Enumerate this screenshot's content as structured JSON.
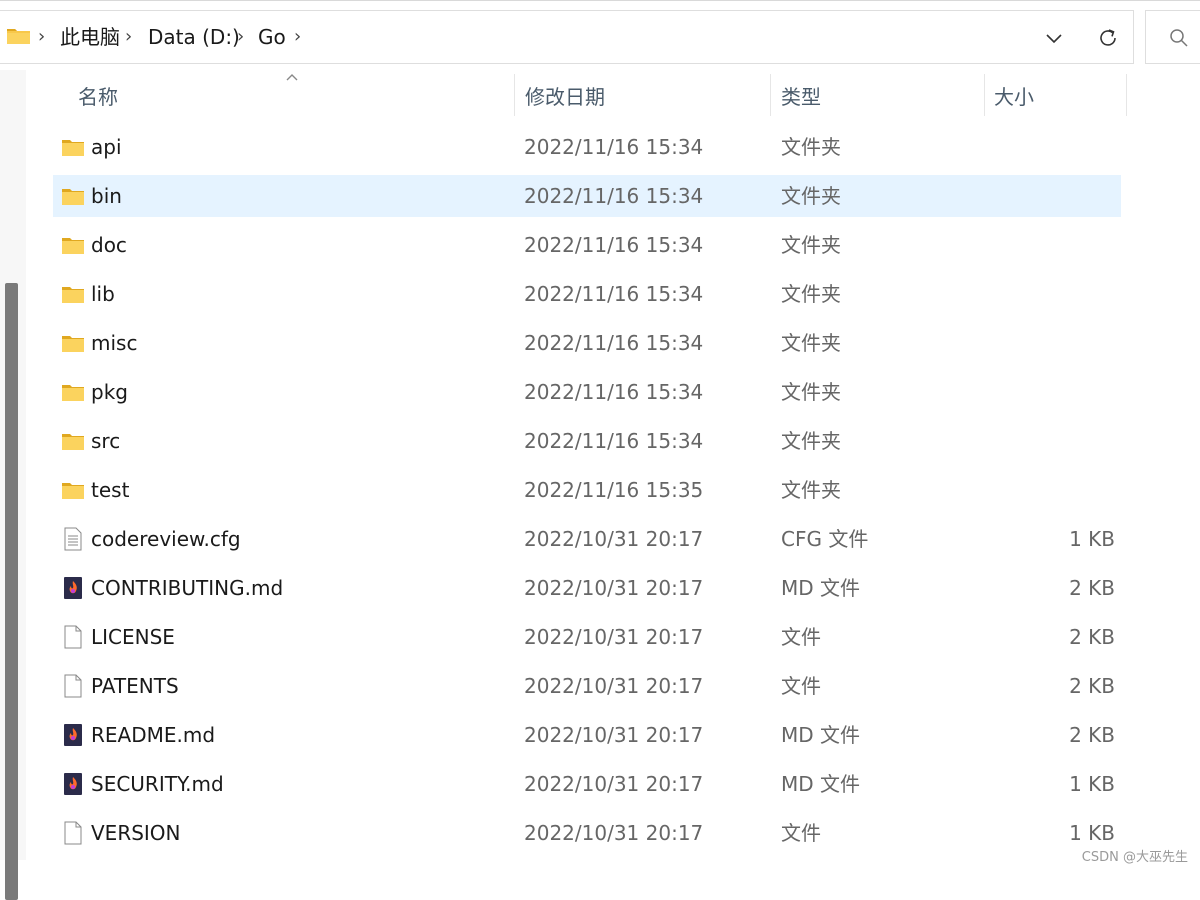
{
  "address": {
    "crumbs": [
      "此电脑",
      "Data (D:)",
      "Go"
    ]
  },
  "columns": {
    "name": "名称",
    "date": "修改日期",
    "type": "类型",
    "size": "大小"
  },
  "rows": [
    {
      "name": "api",
      "date": "2022/11/16 15:34",
      "type": "文件夹",
      "size": "",
      "icon": "folder-icon",
      "selected": false
    },
    {
      "name": "bin",
      "date": "2022/11/16 15:34",
      "type": "文件夹",
      "size": "",
      "icon": "folder-icon",
      "selected": true
    },
    {
      "name": "doc",
      "date": "2022/11/16 15:34",
      "type": "文件夹",
      "size": "",
      "icon": "folder-icon",
      "selected": false
    },
    {
      "name": "lib",
      "date": "2022/11/16 15:34",
      "type": "文件夹",
      "size": "",
      "icon": "folder-icon",
      "selected": false
    },
    {
      "name": "misc",
      "date": "2022/11/16 15:34",
      "type": "文件夹",
      "size": "",
      "icon": "folder-icon",
      "selected": false
    },
    {
      "name": "pkg",
      "date": "2022/11/16 15:34",
      "type": "文件夹",
      "size": "",
      "icon": "folder-icon",
      "selected": false
    },
    {
      "name": "src",
      "date": "2022/11/16 15:34",
      "type": "文件夹",
      "size": "",
      "icon": "folder-icon",
      "selected": false
    },
    {
      "name": "test",
      "date": "2022/11/16 15:35",
      "type": "文件夹",
      "size": "",
      "icon": "folder-icon",
      "selected": false
    },
    {
      "name": "codereview.cfg",
      "date": "2022/10/31 20:17",
      "type": "CFG 文件",
      "size": "1 KB",
      "icon": "config-file-icon",
      "selected": false
    },
    {
      "name": "CONTRIBUTING.md",
      "date": "2022/10/31 20:17",
      "type": "MD 文件",
      "size": "2 KB",
      "icon": "markdown-file-icon",
      "selected": false
    },
    {
      "name": "LICENSE",
      "date": "2022/10/31 20:17",
      "type": "文件",
      "size": "2 KB",
      "icon": "file-icon",
      "selected": false
    },
    {
      "name": "PATENTS",
      "date": "2022/10/31 20:17",
      "type": "文件",
      "size": "2 KB",
      "icon": "file-icon",
      "selected": false
    },
    {
      "name": "README.md",
      "date": "2022/10/31 20:17",
      "type": "MD 文件",
      "size": "2 KB",
      "icon": "markdown-file-icon",
      "selected": false
    },
    {
      "name": "SECURITY.md",
      "date": "2022/10/31 20:17",
      "type": "MD 文件",
      "size": "1 KB",
      "icon": "markdown-file-icon",
      "selected": false
    },
    {
      "name": "VERSION",
      "date": "2022/10/31 20:17",
      "type": "文件",
      "size": "1 KB",
      "icon": "file-icon",
      "selected": false
    }
  ],
  "colors": {
    "selected_row": "#e5f3ff",
    "folder_yellow": "#f8c84a",
    "markdown_icon": "#c0392b"
  },
  "watermark": "CSDN @大巫先生"
}
